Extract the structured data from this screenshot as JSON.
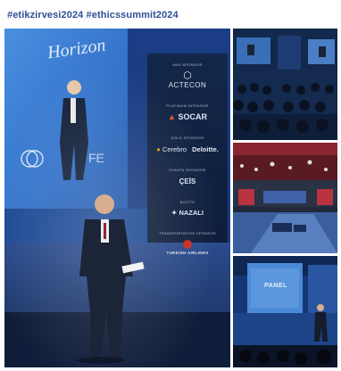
{
  "post": {
    "hashtags": [
      "#etikzirvesi2024",
      "#ethicssummit2024"
    ]
  },
  "colors": {
    "hashtag": "#2f4f95",
    "stage_blue": "#1f4fa8",
    "screen_blue": "#3f7fd0",
    "banner_dark": "#0f1f3c",
    "accent_red": "#c9332b"
  },
  "photo_main": {
    "screen_heading": "Horizon",
    "banner": {
      "sections": [
        {
          "title": "ANA SPONSOR",
          "logos": [
            "ACTECON"
          ]
        },
        {
          "title": "PLATINUM SPONSOR",
          "logos": [
            "SOCAR"
          ]
        },
        {
          "title": "GOLD SPONSOR",
          "logos": [
            "Cerebro",
            "Deloitte."
          ]
        },
        {
          "title": "STANTA SPONSOR",
          "logos": [
            "ÇEİS"
          ]
        },
        {
          "title": "BOOTH",
          "logos": [
            "NAZALI"
          ]
        },
        {
          "title": "TRANSPORTATION SPONSOR",
          "logos": [
            "TURKISH AIRLINES"
          ]
        }
      ]
    }
  },
  "photo_bottom": {
    "screen_line": "PANEL"
  }
}
